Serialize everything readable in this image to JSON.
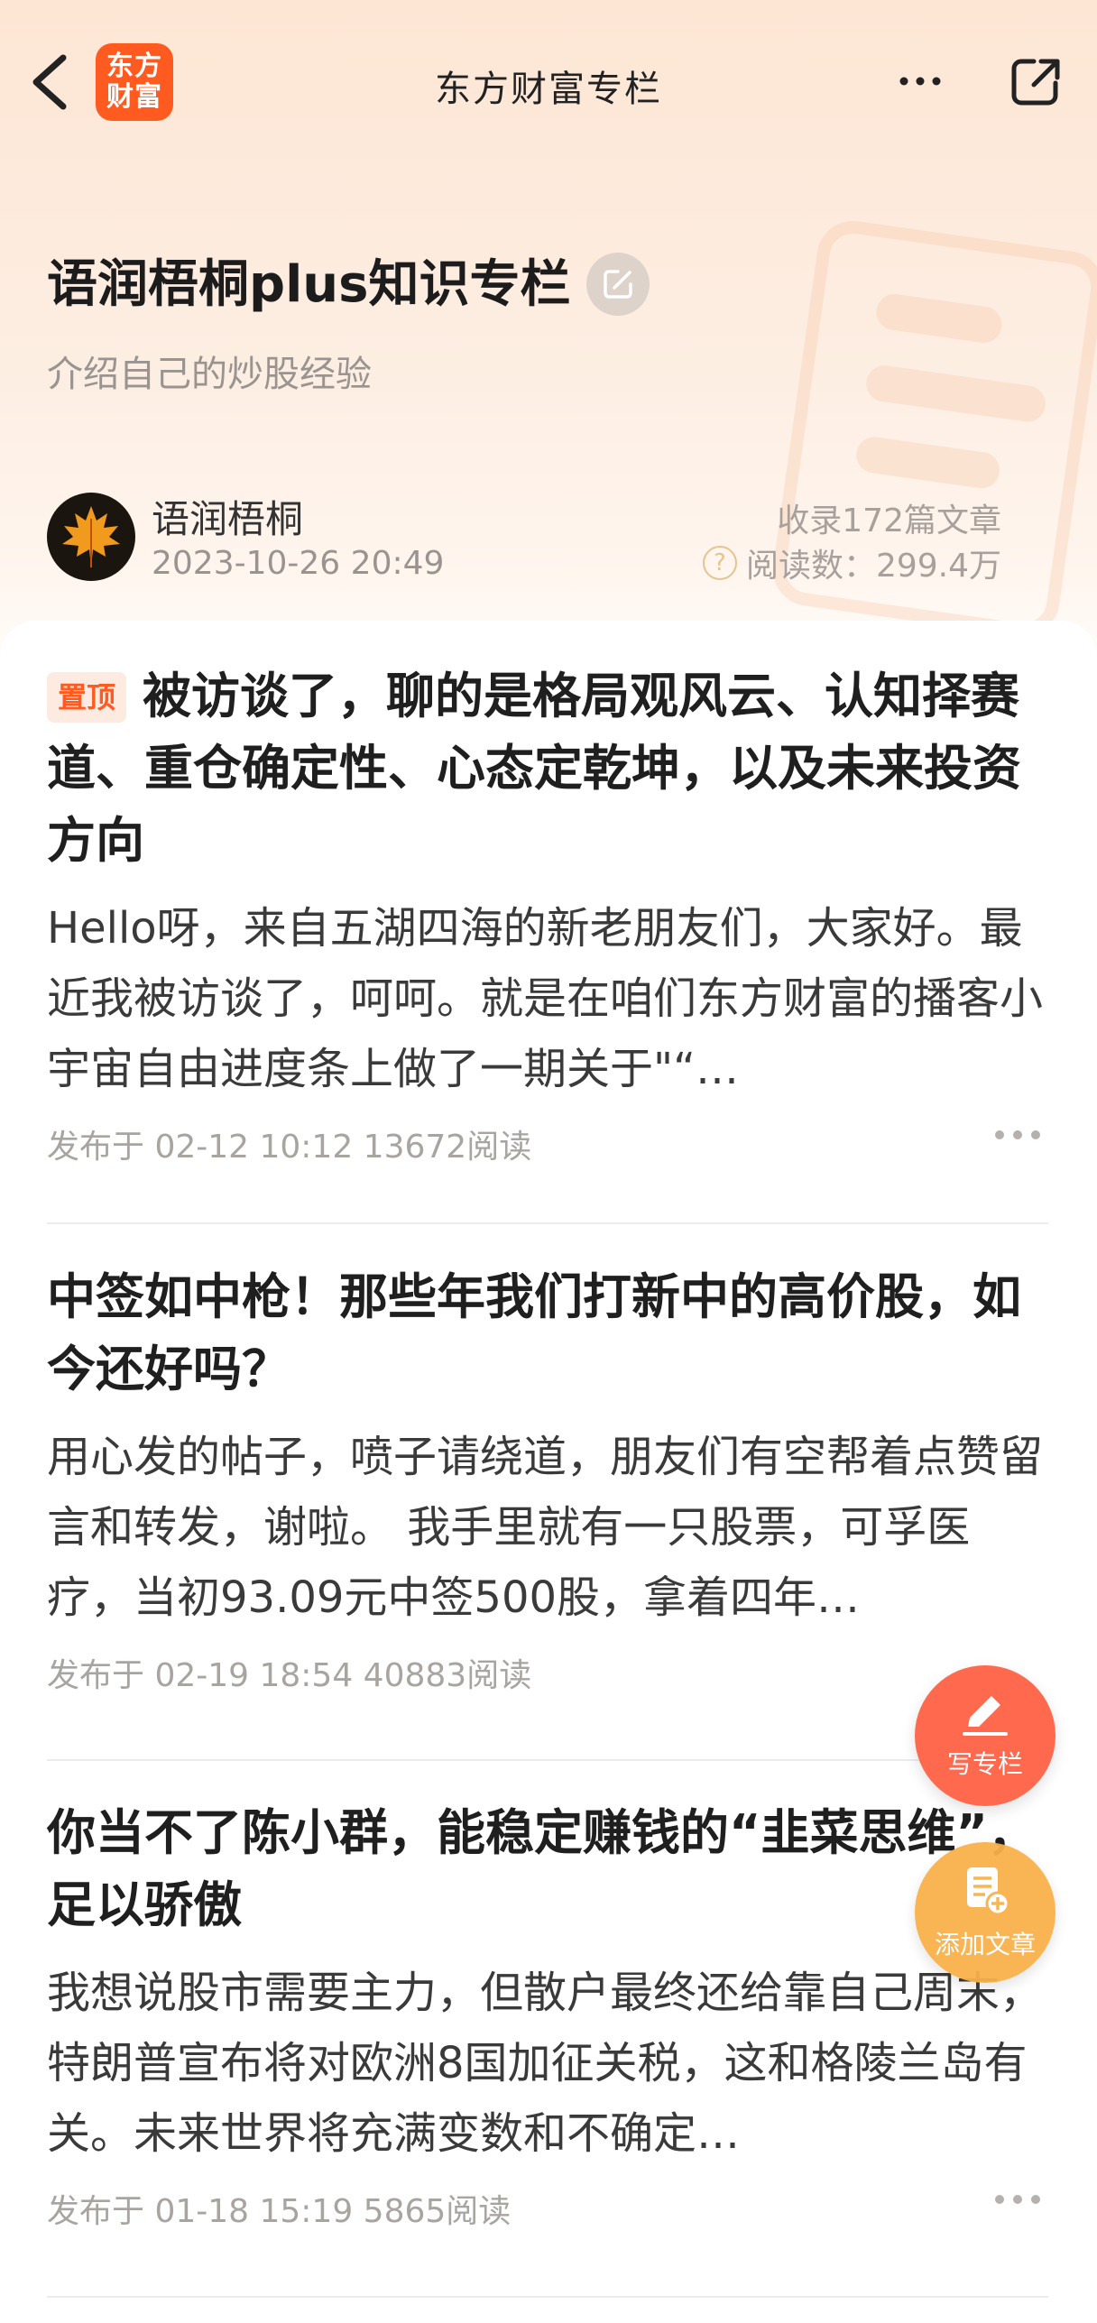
{
  "nav": {
    "logo_line1": "东方",
    "logo_line2": "财富",
    "title": "东方财富专栏"
  },
  "column": {
    "title": "语润梧桐plus知识专栏",
    "description": "介绍自己的炒股经验",
    "author": "语润梧桐",
    "date": "2023-10-26 20:49",
    "article_count": "收录172篇文章",
    "read_count": "阅读数：299.4万"
  },
  "articles": [
    {
      "badge": "置顶",
      "title": "被访谈了，聊的是格局观风云、认知择赛道、重仓确定性、心态定乾坤，以及未来投资方向",
      "snippet": "Hello呀，来自五湖四海的新老朋友们，大家好。最近我被访谈了，呵呵。就是在咱们东方财富的播客小宇宙自由进度条上做了一期关于\"“…",
      "meta": "发布于 02-12 10:12 13672阅读"
    },
    {
      "title": "中签如中枪！那些年我们打新中的高价股，如今还好吗？",
      "snippet": "用心发的帖子，喷子请绕道，朋友们有空帮着点赞留言和转发，谢啦。 我手里就有一只股票，可孚医疗，当初93.09元中签500股，拿着四年…",
      "meta": "发布于 02-19 18:54 40883阅读"
    },
    {
      "title": "你当不了陈小群，能稳定赚钱的“韭菜思维”，足以骄傲",
      "snippet": "我想说股市需要主力，但散户最终还给靠自己周末，特朗普宣布将对欧洲8国加征关税，这和格陵兰岛有关。未来世界将充满变数和不确定…",
      "meta": "发布于 01-18 15:19 5865阅读"
    }
  ],
  "fab": {
    "write_label": "写专栏",
    "add_label": "添加文章"
  },
  "colors": {
    "brand": "#ff5a1f",
    "fab_write": "#ff6a4f",
    "fab_add": "#f9b14a"
  }
}
